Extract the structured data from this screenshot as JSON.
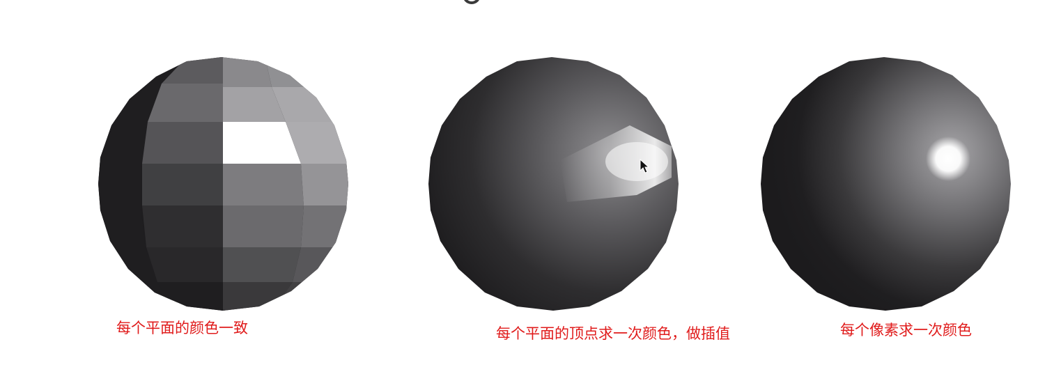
{
  "captions": {
    "flat": "每个平面的颜色一致",
    "gouraud": "每个平面的顶点求一次颜色，做插值",
    "phong": "每个像素求一次颜色"
  },
  "colors": {
    "caption": "#e01b1b",
    "sphere_dark": "#1c1b1d",
    "highlight": "#ffffff"
  },
  "icons": {
    "cursor": "mouse-pointer-icon"
  }
}
